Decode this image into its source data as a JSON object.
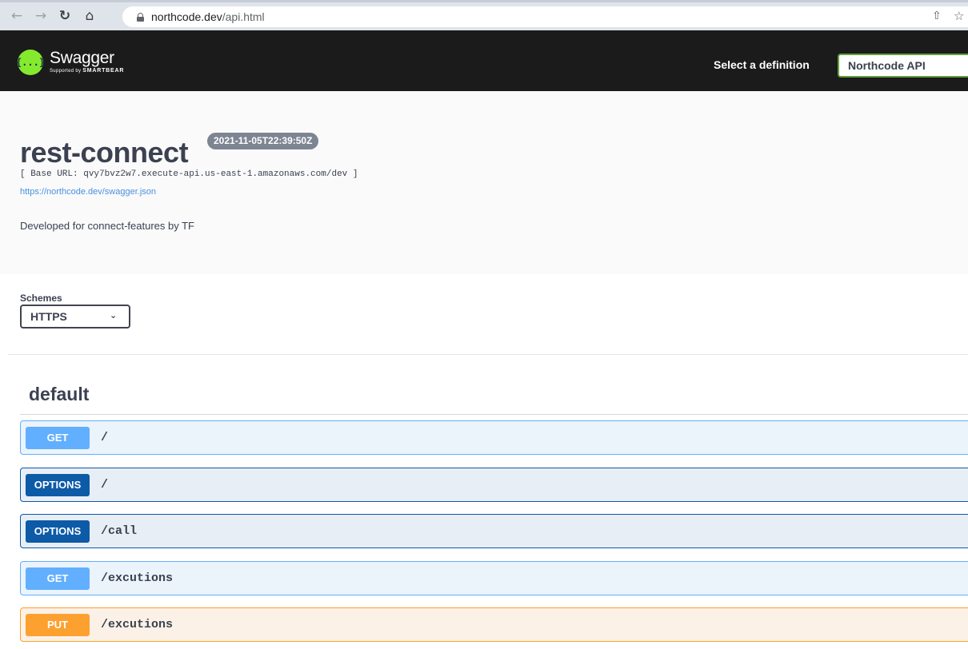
{
  "browser": {
    "url_host": "northcode.dev",
    "url_path": "/api.html"
  },
  "topbar": {
    "logo_name": "Swagger",
    "logo_supported_by": "Supported by",
    "logo_brand": "SMARTBEAR",
    "definition_label": "Select a definition",
    "definition_value": "Northcode API"
  },
  "info": {
    "title": "rest-connect",
    "version": "2021-11-05T22:39:50Z",
    "base_url": "[ Base URL: qvy7bvz2w7.execute-api.us-east-1.amazonaws.com/dev ]",
    "spec_link": "https://northcode.dev/swagger.json",
    "description": "Developed for connect-features by TF"
  },
  "schemes": {
    "label": "Schemes",
    "value": "HTTPS"
  },
  "tag": {
    "name": "default",
    "operations": [
      {
        "method": "GET",
        "path": "/"
      },
      {
        "method": "OPTIONS",
        "path": "/"
      },
      {
        "method": "OPTIONS",
        "path": "/call"
      },
      {
        "method": "GET",
        "path": "/excutions"
      },
      {
        "method": "PUT",
        "path": "/excutions"
      }
    ]
  },
  "colors": {
    "get": "#61affe",
    "options": "#0d5aa7",
    "put": "#fca130",
    "topbar": "#1b1b1b",
    "swagger_green": "#85ea2d"
  }
}
